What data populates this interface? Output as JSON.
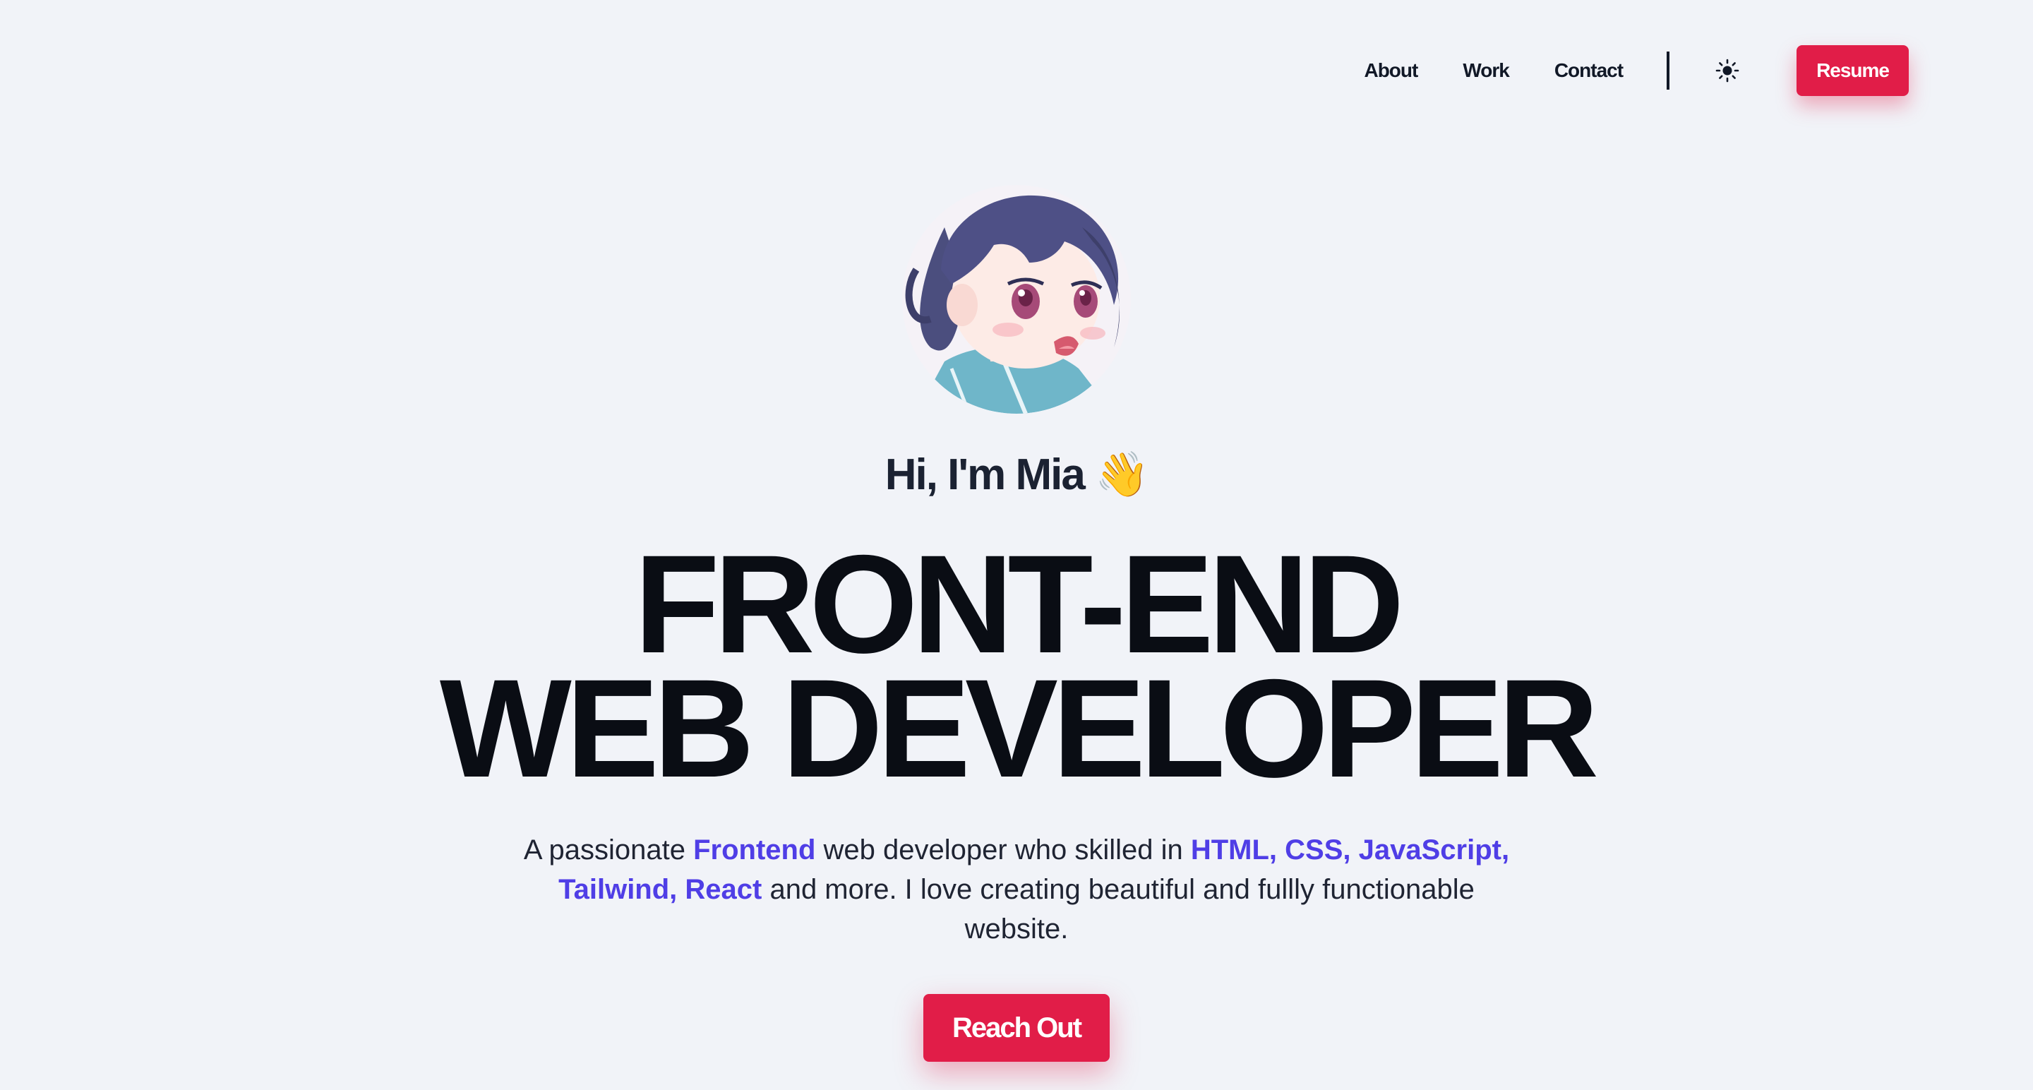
{
  "nav": {
    "links": [
      {
        "label": "About"
      },
      {
        "label": "Work"
      },
      {
        "label": "Contact"
      }
    ],
    "theme_toggle_icon": "sun-icon",
    "resume_label": "Resume"
  },
  "hero": {
    "greeting": "Hi, I'm Mia 👋",
    "headline_line1": "FRONT-END",
    "headline_line2": "WEB DEVELOPER",
    "intro": {
      "part1": "A passionate ",
      "highlight1": "Frontend",
      "part2": " web developer who skilled in ",
      "highlight2": "HTML, CSS, JavaScript, Tailwind, React",
      "part3": " and more. I love creating beautiful and fullly functionable website."
    },
    "cta_label": "Reach Out"
  },
  "colors": {
    "background": "#f1f3f8",
    "accent": "#e11d48",
    "highlight": "#4f3ee6",
    "text": "#0a0d14"
  }
}
